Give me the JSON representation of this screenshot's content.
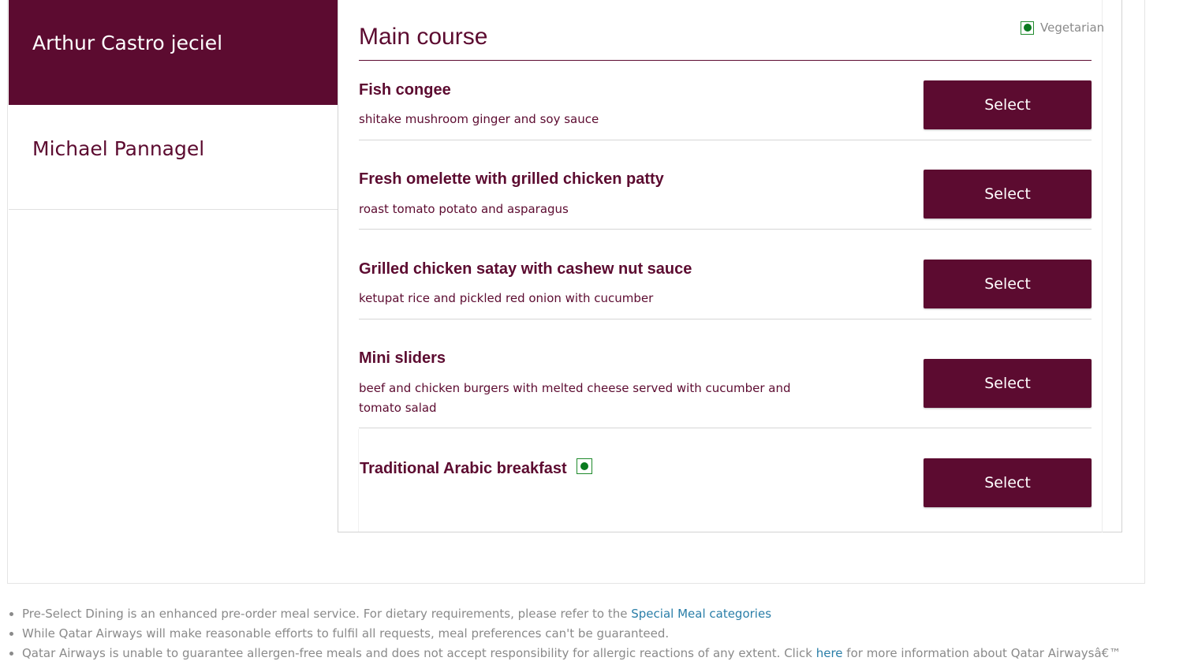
{
  "passengers": [
    {
      "name": "Arthur Castro jeciel",
      "active": true
    },
    {
      "name": "Michael Pannagel",
      "active": false
    }
  ],
  "section": {
    "title": "Main course",
    "legend_label": "Vegetarian",
    "accent_color": "#5c0b30",
    "veg_color": "#0a7a1f"
  },
  "dishes": [
    {
      "name": "Fish congee",
      "description": "shitake mushroom ginger and soy sauce",
      "vegetarian": false,
      "button_label": "Select"
    },
    {
      "name": "Fresh omelette with grilled chicken patty",
      "description": "roast tomato potato and asparagus",
      "vegetarian": false,
      "button_label": "Select"
    },
    {
      "name": "Grilled chicken satay with cashew nut sauce",
      "description": "ketupat rice and pickled red onion with cucumber",
      "vegetarian": false,
      "button_label": "Select"
    },
    {
      "name": "Mini sliders",
      "description": "beef and chicken burgers with melted cheese served with cucumber and tomato salad",
      "vegetarian": false,
      "button_label": "Select"
    },
    {
      "name": "Traditional Arabic breakfast",
      "description": "",
      "vegetarian": true,
      "button_label": "Select"
    }
  ],
  "notes": {
    "note1_text": "Pre-Select Dining is an enhanced pre-order meal service. For dietary requirements, please refer to the ",
    "note1_link": "Special Meal categories",
    "note2_text": "While Qatar Airways will make reasonable efforts to fulfil all requests, meal preferences can't be guaranteed.",
    "note3_text": "Qatar Airways is unable to guarantee allergen-free meals and does not accept responsibility for allergic reactions of any extent. Click ",
    "note3_link": "here",
    "note3_tail": " for more information about Qatar Airwaysâ€™"
  }
}
